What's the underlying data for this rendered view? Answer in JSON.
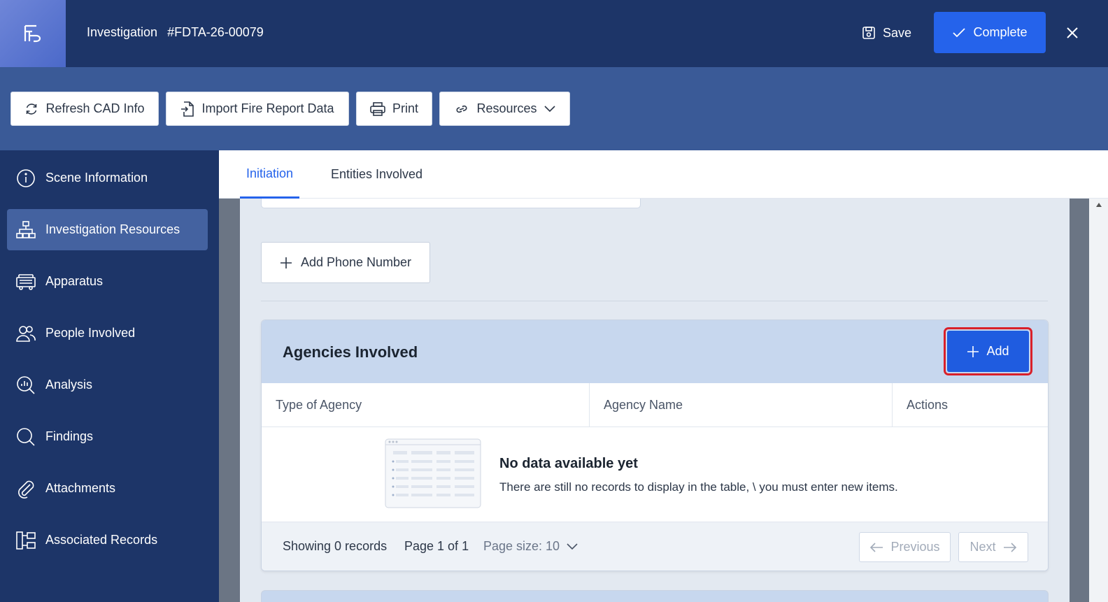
{
  "header": {
    "title": "Investigation",
    "record_number": "#FDTA-26-00079",
    "save_label": "Save",
    "complete_label": "Complete"
  },
  "toolbar": {
    "refresh_label": "Refresh CAD Info",
    "import_label": "Import Fire Report Data",
    "print_label": "Print",
    "resources_label": "Resources"
  },
  "sidebar": {
    "items": [
      {
        "label": "Scene Information",
        "icon": "info-circle-icon"
      },
      {
        "label": "Investigation Resources",
        "icon": "hierarchy-icon",
        "active": true
      },
      {
        "label": "Apparatus",
        "icon": "fire-truck-icon"
      },
      {
        "label": "People Involved",
        "icon": "people-icon"
      },
      {
        "label": "Analysis",
        "icon": "chart-search-icon"
      },
      {
        "label": "Findings",
        "icon": "search-icon"
      },
      {
        "label": "Attachments",
        "icon": "paperclip-icon"
      },
      {
        "label": "Associated Records",
        "icon": "linked-records-icon"
      }
    ]
  },
  "tabs": [
    {
      "label": "Initiation",
      "active": true
    },
    {
      "label": "Entities Involved"
    }
  ],
  "content": {
    "add_phone_label": "Add Phone Number",
    "agencies": {
      "title": "Agencies Involved",
      "add_label": "Add",
      "columns": [
        "Type of Agency",
        "Agency Name",
        "Actions"
      ],
      "empty_title": "No data available yet",
      "empty_desc": "There are still no records to display in the table, \\ you must enter new items.",
      "showing": "Showing 0 records",
      "page": "Page 1 of 1",
      "page_size": "Page size: 10",
      "previous_label": "Previous",
      "next_label": "Next"
    }
  },
  "colors": {
    "header_bg": "#1d3568",
    "toolbar_bg": "#3a5a97",
    "accent": "#2563eb",
    "highlight": "#d9202a"
  }
}
